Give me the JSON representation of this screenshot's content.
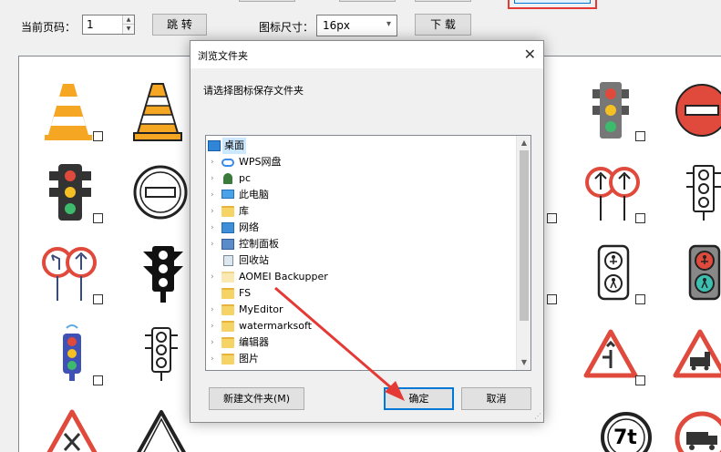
{
  "toolbar": {
    "page_label": "当前页码：",
    "page_value": "1",
    "jump_label": "跳 转",
    "size_label": "图标尺寸：",
    "size_value": "16px",
    "download_label": "下 载"
  },
  "dialog": {
    "title": "浏览文件夹",
    "prompt": "请选择图标保存文件夹",
    "tree": [
      {
        "label": "桌面",
        "icon": "desktop-icon",
        "selected": true
      },
      {
        "label": "WPS网盘",
        "icon": "cloud-icon"
      },
      {
        "label": "pc",
        "icon": "user-icon"
      },
      {
        "label": "此电脑",
        "icon": "computer-icon"
      },
      {
        "label": "库",
        "icon": "library-icon"
      },
      {
        "label": "网络",
        "icon": "network-icon"
      },
      {
        "label": "控制面板",
        "icon": "control-panel-icon"
      },
      {
        "label": "回收站",
        "icon": "recycle-bin-icon"
      },
      {
        "label": "AOMEI Backupper",
        "icon": "folder-icon"
      },
      {
        "label": "FS",
        "icon": "folder-icon"
      },
      {
        "label": "MyEditor",
        "icon": "folder-icon"
      },
      {
        "label": "watermarksoft",
        "icon": "folder-icon"
      },
      {
        "label": "编辑器",
        "icon": "folder-icon"
      },
      {
        "label": "图片",
        "icon": "folder-icon"
      }
    ],
    "new_folder_label": "新建文件夹(M)",
    "ok_label": "确定",
    "cancel_label": "取消"
  },
  "icons": {
    "row1": [
      "traffic-cone-icon",
      "traffic-cone-icon",
      "traffic-light-icon",
      "no-entry-sign-icon"
    ],
    "row2": [
      "traffic-light-icon",
      "no-entry-sign-icon",
      "turn-signs-icon",
      "traffic-light-icon"
    ],
    "row3": [
      "turn-signs-icon",
      "traffic-light-icon",
      "pedestrian-signal-icon",
      "pedestrian-signal-icon"
    ],
    "row4": [
      "traffic-light-icon",
      "traffic-light-icon",
      "warning-sign-icon",
      "warning-sign-icon"
    ],
    "row5": [
      "warning-sign-icon",
      "warning-sign-icon",
      "speed-limit-sign-icon",
      "truck-sign-icon"
    ],
    "weight_limit": "7t"
  },
  "colors": {
    "accent": "#0078d7",
    "highlight": "#e53935",
    "cone_orange": "#f5a623",
    "sign_red": "#e04a3c"
  }
}
